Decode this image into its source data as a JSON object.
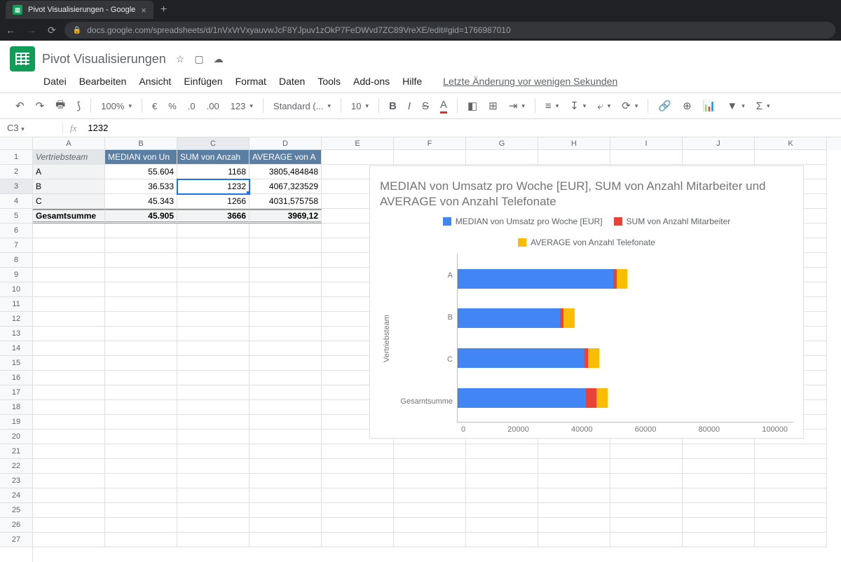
{
  "browser": {
    "tab_title": "Pivot Visualisierungen - Google",
    "url": "docs.google.com/spreadsheets/d/1nVxVrVxyauvwJcF8YJpuv1zOkP7FeDWvd7ZC89VreXE/edit#gid=1766987010"
  },
  "header": {
    "doc_title": "Pivot Visualisierungen",
    "menu": [
      "Datei",
      "Bearbeiten",
      "Ansicht",
      "Einfügen",
      "Format",
      "Daten",
      "Tools",
      "Add-ons",
      "Hilfe"
    ],
    "last_edit": "Letzte Änderung vor wenigen Sekunden"
  },
  "toolbar": {
    "zoom": "100%",
    "currency": "€",
    "percent": "%",
    "dec_dec": ".0",
    "dec_inc": ".00",
    "num_fmt": "123",
    "font_name": "Standard (...",
    "font_size": "10"
  },
  "namebox": {
    "cell": "C3",
    "fx": "fx",
    "value": "1232"
  },
  "columns": [
    "A",
    "B",
    "C",
    "D",
    "E",
    "F",
    "G",
    "H",
    "I",
    "J",
    "K"
  ],
  "pivot": {
    "h0": "Vertriebsteam",
    "h1": "MEDIAN von Un",
    "h2": "SUM von Anzah",
    "h3": "AVERAGE von A",
    "rows": [
      {
        "k": "A",
        "b": "55.604",
        "c": "1168",
        "d": "3805,484848"
      },
      {
        "k": "B",
        "b": "36.533",
        "c": "1232",
        "d": "4067,323529"
      },
      {
        "k": "C",
        "b": "45.343",
        "c": "1266",
        "d": "4031,575758"
      }
    ],
    "total": {
      "k": "Gesamtsumme",
      "b": "45.905",
      "c": "3666",
      "d": "3969,12"
    }
  },
  "chart_data": {
    "type": "bar",
    "orientation": "horizontal",
    "stacked": true,
    "title": "MEDIAN von Umsatz pro Woche [EUR], SUM von Anzahl Mitarbeiter und AVERAGE von Anzahl Telefonate",
    "ylabel": "Vertriebsteam",
    "categories": [
      "A",
      "B",
      "C",
      "Gesamtsumme"
    ],
    "series": [
      {
        "name": "MEDIAN von Umsatz pro Woche [EUR]",
        "color": "#4285f4",
        "values": [
          55604,
          36533,
          45343,
          45905
        ]
      },
      {
        "name": "SUM von Anzahl Mitarbeiter",
        "color": "#ea4335",
        "values": [
          1168,
          1232,
          1266,
          3666
        ]
      },
      {
        "name": "AVERAGE von Anzahl Telefonate",
        "color": "#fbbc04",
        "values": [
          3805,
          4067,
          4032,
          3969
        ]
      }
    ],
    "x_ticks": [
      "0",
      "20000",
      "40000",
      "60000",
      "80000",
      "100000"
    ],
    "xlim": [
      0,
      120000
    ]
  }
}
